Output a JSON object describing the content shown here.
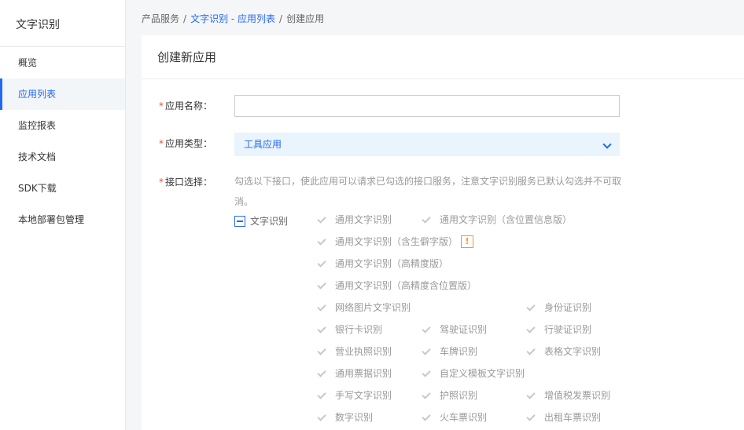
{
  "sidebar": {
    "title": "文字识别",
    "items": [
      {
        "label": "概览"
      },
      {
        "label": "应用列表"
      },
      {
        "label": "监控报表"
      },
      {
        "label": "技术文档"
      },
      {
        "label": "SDK下载"
      },
      {
        "label": "本地部署包管理"
      }
    ],
    "active_index": 1
  },
  "breadcrumb": {
    "root": "产品服务",
    "separator": "/",
    "link": "文字识别 - 应用列表",
    "current": "创建应用"
  },
  "form": {
    "title": "创建新应用",
    "required_mark": "*",
    "name_label": "应用名称：",
    "name_value": "",
    "type_label": "应用类型：",
    "type_value": "工具应用",
    "api_label": "接口选择：",
    "api_description": "勾选以下接口，使此应用可以请求已勾选的接口服务，注意文字识别服务已默认勾选并不可取消。",
    "group_label": "文字识别",
    "warn_glyph": "!",
    "apis": [
      "通用文字识别",
      "通用文字识别（含位置信息版）",
      "通用文字识别（含生僻字版）",
      "通用文字识别（高精度版）",
      "通用文字识别（高精度含位置版）",
      "网络图片文字识别",
      "身份证识别",
      "银行卡识别",
      "驾驶证识别",
      "行驶证识别",
      "营业执照识别",
      "车牌识别",
      "表格文字识别",
      "通用票据识别",
      "自定义模板文字识别",
      "手写文字识别",
      "护照识别",
      "增值税发票识别",
      "数字识别",
      "火车票识别",
      "出租车票识别"
    ]
  },
  "colors": {
    "accent": "#2468f2",
    "required": "#ea4e3d",
    "warning": "#f39c12",
    "select_bg": "#e9f4fd"
  }
}
